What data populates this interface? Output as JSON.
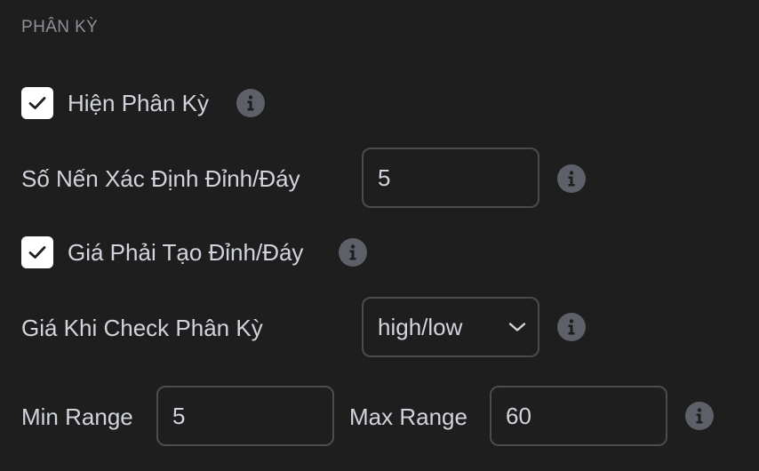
{
  "section": {
    "title": "PHÂN KỲ"
  },
  "show_divergence": {
    "label": "Hiện Phân Kỳ",
    "checked": true,
    "info_icon": "info-icon"
  },
  "pivot_candles": {
    "label": "Số Nến Xác Định Đỉnh/Đáy",
    "value": "5",
    "info_icon": "info-icon"
  },
  "price_pivot": {
    "label": "Giá Phải Tạo Đỉnh/Đáy",
    "checked": true,
    "info_icon": "info-icon"
  },
  "price_source": {
    "label": "Giá Khi Check Phân Kỳ",
    "selected": "high/low",
    "dropdown_icon": "chevron-down-icon",
    "info_icon": "info-icon"
  },
  "range": {
    "min_label": "Min Range",
    "min_value": "5",
    "max_label": "Max Range",
    "max_value": "60",
    "info_icon": "info-icon"
  },
  "colors": {
    "background": "#1e1e1e",
    "text": "#d1d4dc",
    "muted_text": "#8f9199",
    "checkbox": "#ffffff",
    "border": "#4a4c52",
    "info_icon": "#5d6068"
  }
}
